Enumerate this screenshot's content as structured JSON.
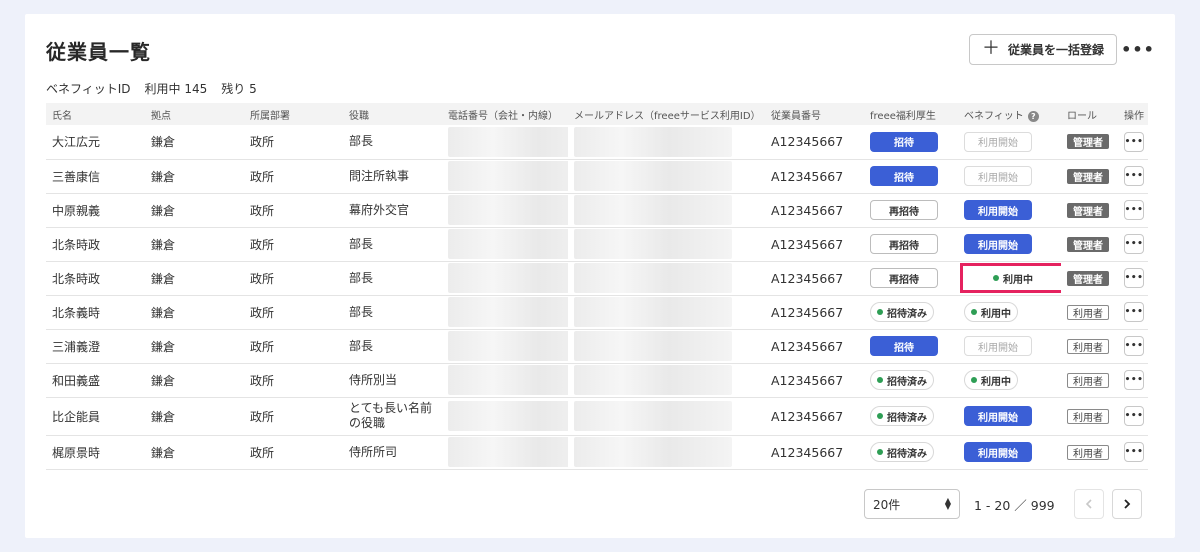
{
  "title": "従業員一覧",
  "bulk_button": "従業員を一括登録",
  "more_glyph": "•••",
  "benefit": {
    "label": "ベネフィットID",
    "in_use": "利用中 145",
    "remaining": "残り 5"
  },
  "columns": [
    "氏名",
    "拠点",
    "所属部署",
    "役職",
    "電話番号（会社・内線）",
    "メールアドレス（freeeサービス利用ID）",
    "従業員番号",
    "freee福利厚生",
    "ベネフィット",
    "ロール",
    "操作"
  ],
  "rows": [
    {
      "name": "大江広元",
      "base": "鎌倉",
      "dept": "政所",
      "position": "部長",
      "emp_no": "A12345667",
      "welfare": "招待",
      "welfare_type": "primary",
      "benefit": "利用開始",
      "benefit_type": "disabled",
      "role": "管理者",
      "role_type": "admin"
    },
    {
      "name": "三善康信",
      "base": "鎌倉",
      "dept": "政所",
      "position": "問注所執事",
      "emp_no": "A12345667",
      "welfare": "招待",
      "welfare_type": "primary",
      "benefit": "利用開始",
      "benefit_type": "disabled",
      "role": "管理者",
      "role_type": "admin"
    },
    {
      "name": "中原親義",
      "base": "鎌倉",
      "dept": "政所",
      "position": "幕府外交官",
      "emp_no": "A12345667",
      "welfare": "再招待",
      "welfare_type": "outline",
      "benefit": "利用開始",
      "benefit_type": "primary",
      "role": "管理者",
      "role_type": "admin"
    },
    {
      "name": "北条時政",
      "base": "鎌倉",
      "dept": "政所",
      "position": "部長",
      "emp_no": "A12345667",
      "welfare": "再招待",
      "welfare_type": "outline",
      "benefit": "利用開始",
      "benefit_type": "primary",
      "role": "管理者",
      "role_type": "admin"
    },
    {
      "name": "北条時政",
      "base": "鎌倉",
      "dept": "政所",
      "position": "部長",
      "emp_no": "A12345667",
      "welfare": "再招待",
      "welfare_type": "outline",
      "benefit": "利用中",
      "benefit_type": "status-highlight",
      "role": "管理者",
      "role_type": "admin"
    },
    {
      "name": "北条義時",
      "base": "鎌倉",
      "dept": "政所",
      "position": "部長",
      "emp_no": "A12345667",
      "welfare": "招待済み",
      "welfare_type": "status",
      "benefit": "利用中",
      "benefit_type": "status",
      "role": "利用者",
      "role_type": "user"
    },
    {
      "name": "三浦義澄",
      "base": "鎌倉",
      "dept": "政所",
      "position": "部長",
      "emp_no": "A12345667",
      "welfare": "招待",
      "welfare_type": "primary",
      "benefit": "利用開始",
      "benefit_type": "disabled",
      "role": "利用者",
      "role_type": "user"
    },
    {
      "name": "和田義盛",
      "base": "鎌倉",
      "dept": "政所",
      "position": "侍所別当",
      "emp_no": "A12345667",
      "welfare": "招待済み",
      "welfare_type": "status",
      "benefit": "利用中",
      "benefit_type": "status",
      "role": "利用者",
      "role_type": "user"
    },
    {
      "name": "比企能員",
      "base": "鎌倉",
      "dept": "政所",
      "position": "とても長い名前の役職",
      "emp_no": "A12345667",
      "welfare": "招待済み",
      "welfare_type": "status",
      "benefit": "利用開始",
      "benefit_type": "primary",
      "role": "利用者",
      "role_type": "user"
    },
    {
      "name": "梶原景時",
      "base": "鎌倉",
      "dept": "政所",
      "position": "侍所所司",
      "emp_no": "A12345667",
      "welfare": "招待済み",
      "welfare_type": "status",
      "benefit": "利用開始",
      "benefit_type": "primary",
      "role": "利用者",
      "role_type": "user"
    }
  ],
  "pagination": {
    "per_page": "20件",
    "range": "1 - 20 ／ 999"
  },
  "colors": {
    "primary": "#3b5fd6",
    "highlight": "#e5225f",
    "status_dot": "#2e9e55",
    "admin_badge": "#6a6a6a"
  },
  "icons": {
    "add": "plus-icon",
    "help": "help-icon",
    "prev": "chevron-left-icon",
    "next": "chevron-right-icon"
  }
}
